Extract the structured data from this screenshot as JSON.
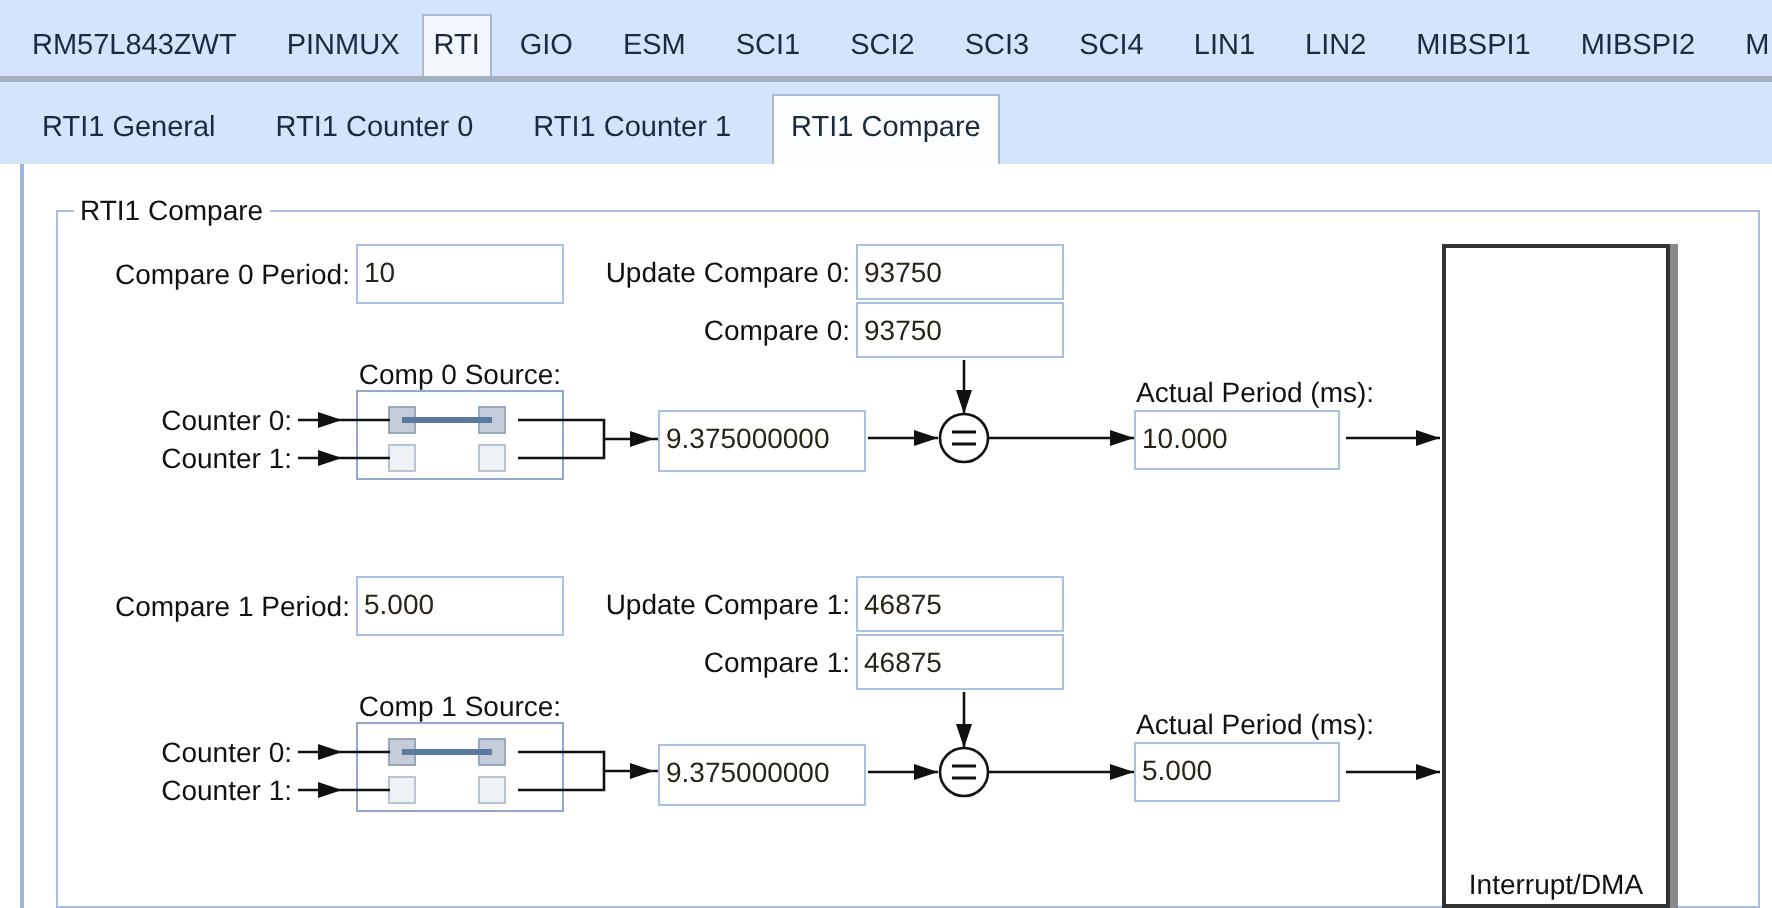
{
  "top_tabs": [
    {
      "label": "RM57L843ZWT",
      "selected": false
    },
    {
      "label": "PINMUX",
      "selected": false
    },
    {
      "label": "RTI",
      "selected": true
    },
    {
      "label": "GIO",
      "selected": false
    },
    {
      "label": "ESM",
      "selected": false
    },
    {
      "label": "SCI1",
      "selected": false
    },
    {
      "label": "SCI2",
      "selected": false
    },
    {
      "label": "SCI3",
      "selected": false
    },
    {
      "label": "SCI4",
      "selected": false
    },
    {
      "label": "LIN1",
      "selected": false
    },
    {
      "label": "LIN2",
      "selected": false
    },
    {
      "label": "MIBSPI1",
      "selected": false
    },
    {
      "label": "MIBSPI2",
      "selected": false
    },
    {
      "label": "M",
      "selected": false
    }
  ],
  "sub_tabs": [
    {
      "label": "RTI1 General",
      "selected": false
    },
    {
      "label": "RTI1 Counter 0",
      "selected": false
    },
    {
      "label": "RTI1 Counter 1",
      "selected": false
    },
    {
      "label": "RTI1 Compare",
      "selected": true
    }
  ],
  "group": {
    "title": "RTI1 Compare",
    "compares": [
      {
        "period_label": "Compare 0 Period:",
        "period_value": "10",
        "update_label": "Update Compare 0:",
        "update_value": "93750",
        "compare_label": "Compare 0:",
        "compare_value": "93750",
        "source_label": "Comp 0 Source:",
        "source_inputs": [
          {
            "label": "Counter 0:",
            "selected": true
          },
          {
            "label": "Counter 1:",
            "selected": false
          }
        ],
        "result_value": "9.375000000",
        "actual_label": "Actual Period (ms):",
        "actual_value": "10.000"
      },
      {
        "period_label": "Compare 1 Period:",
        "period_value": "5.000",
        "update_label": "Update Compare 1:",
        "update_value": "46875",
        "compare_label": "Compare 1:",
        "compare_value": "46875",
        "source_label": "Comp 1 Source:",
        "source_inputs": [
          {
            "label": "Counter 0:",
            "selected": true
          },
          {
            "label": "Counter 1:",
            "selected": false
          }
        ],
        "result_value": "9.375000000",
        "actual_label": "Actual Period (ms):",
        "actual_value": "5.000"
      }
    ],
    "output_block": {
      "label": "Interrupt/DMA"
    }
  }
}
